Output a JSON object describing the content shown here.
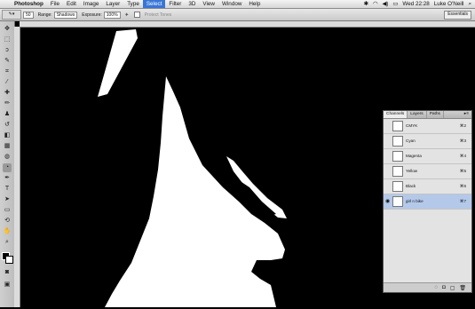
{
  "menubar": {
    "app": "Photoshop",
    "items": [
      "File",
      "Edit",
      "Image",
      "Layer",
      "Type",
      "Select",
      "Filter",
      "3D",
      "View",
      "Window",
      "Help"
    ],
    "active_item": "Select",
    "clock": "Wed 22:28",
    "user": "Luke O'Neill"
  },
  "options": {
    "brush_size": "50",
    "range_label": "Range:",
    "range_value": "Shadows",
    "exposure_label": "Exposure:",
    "exposure_value": "100%",
    "protect_tones": "Protect Tones",
    "workspace": "Essentials"
  },
  "panel": {
    "tabs": [
      "Channels",
      "Layers",
      "Paths"
    ],
    "channels": [
      {
        "name": "CMYK",
        "key": "⌘2"
      },
      {
        "name": "Cyan",
        "key": "⌘3"
      },
      {
        "name": "Magenta",
        "key": "⌘4"
      },
      {
        "name": "Yellow",
        "key": "⌘5"
      },
      {
        "name": "Black",
        "key": "⌘6"
      },
      {
        "name": "girl n bike",
        "key": "⌘7"
      }
    ]
  }
}
